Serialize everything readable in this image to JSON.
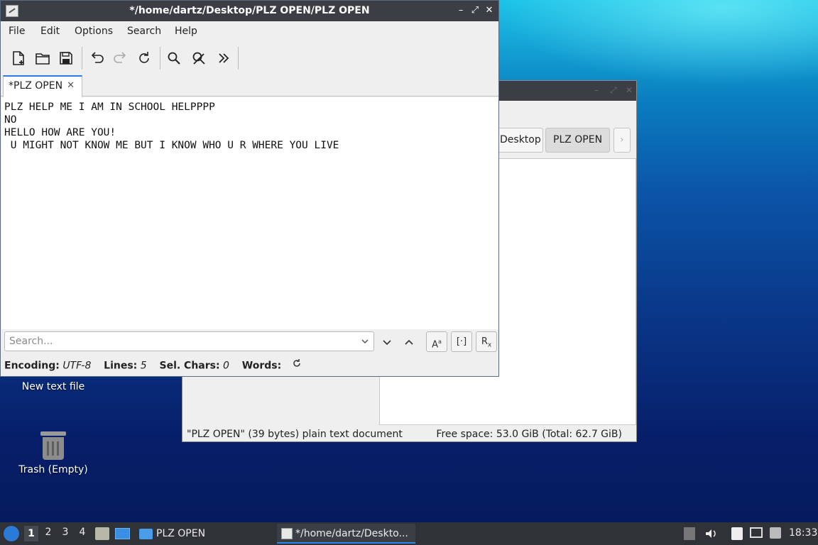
{
  "desktop": {
    "icons": [
      {
        "label": "New text file"
      },
      {
        "label": "Trash (Empty)"
      }
    ]
  },
  "file_manager": {
    "breadcrumbs": [
      "Desktop",
      "PLZ OPEN"
    ],
    "status_left": "\"PLZ OPEN\" (39 bytes) plain text document",
    "status_right": "Free space: 53.0 GiB (Total: 62.7 GiB)"
  },
  "editor": {
    "title": "*/home/dartz/Desktop/PLZ OPEN/PLZ OPEN",
    "menu": [
      "File",
      "Edit",
      "Options",
      "Search",
      "Help"
    ],
    "toolbar_icons": [
      "new-file-icon",
      "open-file-icon",
      "save-icon",
      "undo-icon",
      "redo-icon",
      "reload-icon",
      "find-icon",
      "replace-icon",
      "more-icon"
    ],
    "tab_label": "*PLZ OPEN",
    "lines": [
      "PLZ HELP ME I AM IN SCHOOL HELPPPP",
      "NO",
      "HELLO HOW ARE YOU!",
      " U MIGHT NOT KNOW ME BUT I KNOW WHO U R WHERE YOU LIVE"
    ],
    "search_placeholder": "Search...",
    "status": {
      "encoding_label": "Encoding:",
      "encoding_value": "UTF-8",
      "lines_label": "Lines:",
      "lines_value": "5",
      "sel_label": "Sel. Chars:",
      "sel_value": "0",
      "words_label": "Words:"
    }
  },
  "taskbar": {
    "workspaces": [
      "1",
      "2",
      "3",
      "4"
    ],
    "tasks": [
      {
        "label": "PLZ OPEN"
      },
      {
        "label": "*/home/dartz/Deskto..."
      }
    ],
    "clock": "18:33"
  },
  "colors": {
    "accent": "#2a7be4",
    "titlebar": "#3b3f45",
    "taskbar": "#2f3338"
  }
}
